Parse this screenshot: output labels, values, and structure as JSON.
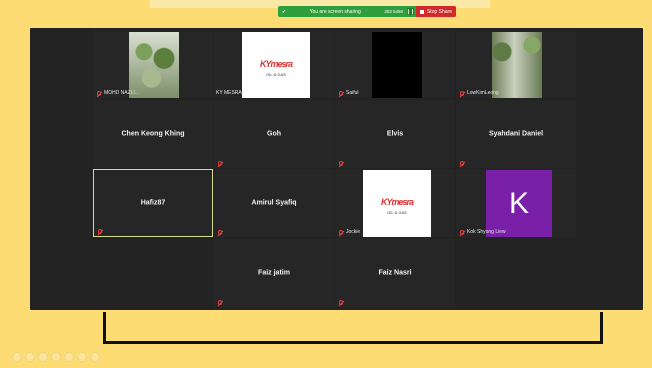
{
  "share_bar": {
    "status": "You are screen sharing",
    "meeting_id": "303 5456",
    "stop_label": "Stop Share"
  },
  "tiles": [
    {
      "name": "MOHD NAZLI...",
      "kind": "video"
    },
    {
      "name": "KY MESRA",
      "kind": "logo"
    },
    {
      "name": "Saiful",
      "kind": "video-black"
    },
    {
      "name": "LowKimLeong",
      "kind": "video"
    },
    {
      "name": "Chen Keong Khing",
      "kind": "name"
    },
    {
      "name": "Goh",
      "kind": "name"
    },
    {
      "name": "Elvis",
      "kind": "name"
    },
    {
      "name": "Syahdani Daniel",
      "kind": "name"
    },
    {
      "name": "Hafiz87",
      "kind": "name"
    },
    {
      "name": "Amirul Syafiq",
      "kind": "name"
    },
    {
      "name": "Jockie",
      "kind": "logo"
    },
    {
      "name": "Kok Shyong Liew",
      "kind": "avatar"
    },
    {
      "name": "Faiz jatim",
      "kind": "name"
    },
    {
      "name": "Faiz Nasri",
      "kind": "name"
    }
  ],
  "logo": {
    "main": "KY",
    "script": "mesra",
    "sub": "OIL & GAS"
  },
  "avatar_letter": "K",
  "colors": {
    "accent_green": "#2f9e3c",
    "stop_red": "#d22a2a",
    "avatar_purple": "#7a1fa8",
    "background": "#fddc73"
  }
}
